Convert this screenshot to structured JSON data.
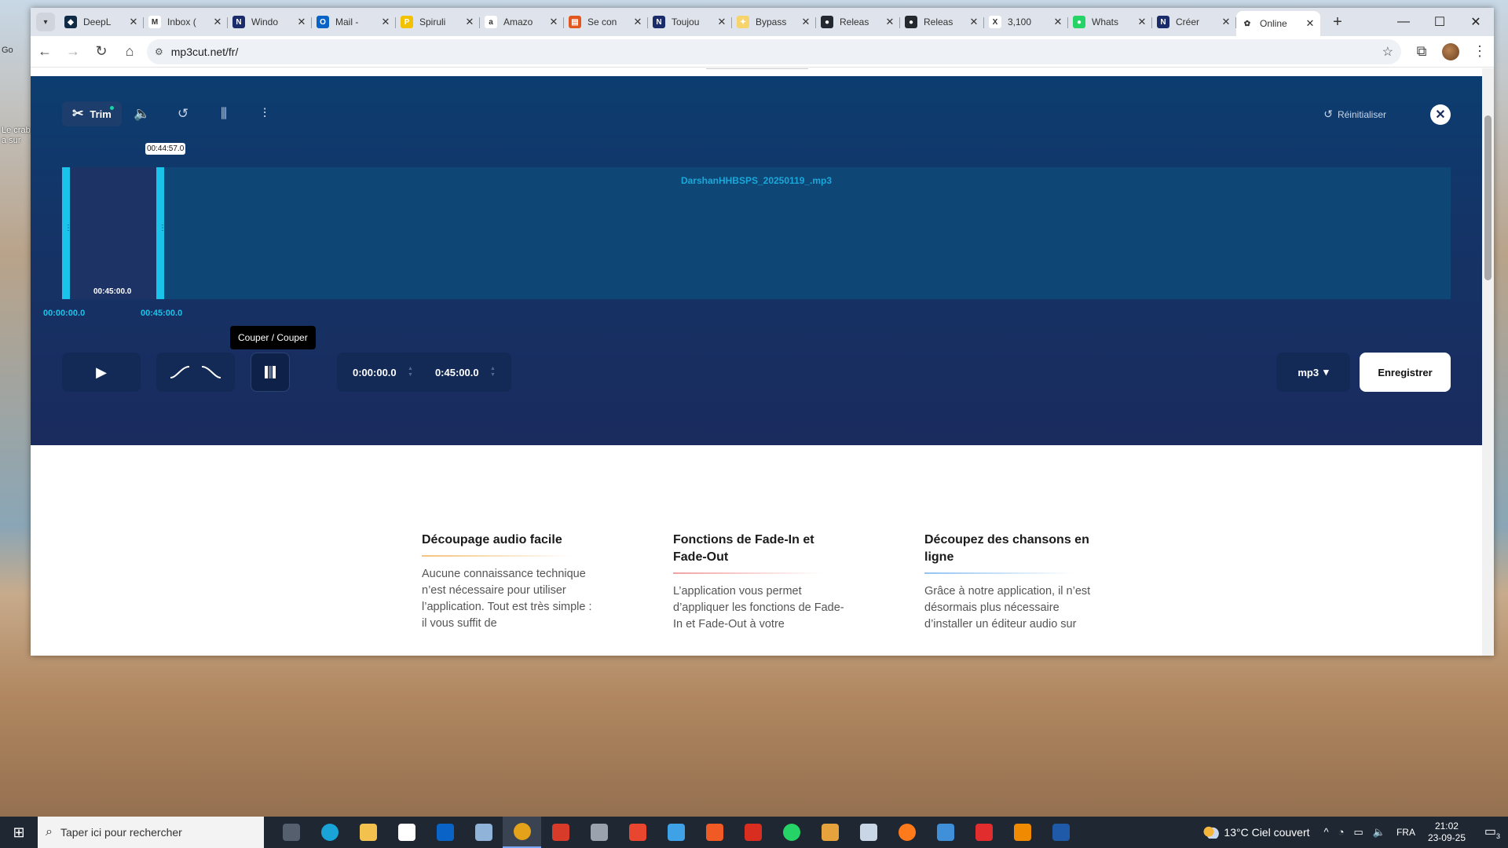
{
  "desktop": {
    "icon_text": "Le crab a sur",
    "icon_text2": "Go"
  },
  "browser": {
    "tabs": [
      {
        "title": "DeepL",
        "color": "#0f2b46",
        "glyph": "◆"
      },
      {
        "title": "Inbox (",
        "color": "#ffffff",
        "glyph": "M"
      },
      {
        "title": "Windo",
        "color": "#1b2c6b",
        "glyph": "N"
      },
      {
        "title": "Mail -",
        "color": "#0a64c8",
        "glyph": "O"
      },
      {
        "title": "Spiruli",
        "color": "#f2c200",
        "glyph": "P"
      },
      {
        "title": "Amazo",
        "color": "#ffffff",
        "glyph": "a"
      },
      {
        "title": "Se con",
        "color": "#e2571e",
        "glyph": "▤"
      },
      {
        "title": "Toujou",
        "color": "#1b2c6b",
        "glyph": "N"
      },
      {
        "title": "Bypass",
        "color": "#f6d36b",
        "glyph": "✦"
      },
      {
        "title": "Releas",
        "color": "#24292f",
        "glyph": "●"
      },
      {
        "title": "Releas",
        "color": "#24292f",
        "glyph": "●"
      },
      {
        "title": "3,100",
        "color": "#ffffff",
        "glyph": "X"
      },
      {
        "title": "Whats",
        "color": "#25d366",
        "glyph": "●"
      },
      {
        "title": "Créer",
        "color": "#1b2c6b",
        "glyph": "N"
      },
      {
        "title": "Online",
        "color": "#ffffff",
        "glyph": "✿",
        "active": true
      }
    ],
    "url": "mp3cut.net/fr/",
    "window_controls": [
      "—",
      "☐",
      "✕"
    ]
  },
  "editor": {
    "tool_trim_label": "Trim",
    "reset_label": "Réinitialiser",
    "filename": "DarshanHHBSPS_20250119_.mp3",
    "selection_duration": "00:45:00.0",
    "cursor_time": "00:44:57.0",
    "start_label": "00:00:00.0",
    "end_label": "00:45:00.0",
    "tooltip": "Couper / Couper",
    "start_time": "0:00:00.0",
    "end_time": "0:45:00.0",
    "format": "mp3",
    "save_label": "Enregistrer",
    "selection_fraction": 0.068
  },
  "features": [
    {
      "title": "Découpage audio facile",
      "text": "Aucune connaissance technique n’est nécessaire pour utiliser l’application. Tout est très simple : il vous suffit de"
    },
    {
      "title": "Fonctions de Fade-In et Fade-Out",
      "text": "L’application vous permet d’appliquer les fonctions de Fade-In et Fade-Out à votre"
    },
    {
      "title": "Découpez des chansons en ligne",
      "text": "Grâce à notre application, il n’est désormais plus nécessaire d’installer un éditeur audio sur"
    }
  ],
  "taskbar": {
    "search_placeholder": "Taper ici pour rechercher",
    "weather": "13°C  Ciel couvert",
    "lang": "FRA",
    "time": "21:02",
    "date": "23-09-25",
    "notif_count": "3",
    "apps": [
      {
        "name": "task-view",
        "color": "#555f6e"
      },
      {
        "name": "edge",
        "color": "#1aa3d6"
      },
      {
        "name": "file-explorer",
        "color": "#f2c14e"
      },
      {
        "name": "store",
        "color": "#ffffff"
      },
      {
        "name": "outlook",
        "color": "#0a64c8"
      },
      {
        "name": "remote-desktop",
        "color": "#8fb3d9"
      },
      {
        "name": "chrome",
        "color": "#e3a21a",
        "active": true
      },
      {
        "name": "app-red",
        "color": "#d93b2b"
      },
      {
        "name": "calculator",
        "color": "#9aa3ad"
      },
      {
        "name": "app-swirl",
        "color": "#e8462f"
      },
      {
        "name": "app-blue",
        "color": "#3fa2e6"
      },
      {
        "name": "brave",
        "color": "#f05a24"
      },
      {
        "name": "app-acrobat",
        "color": "#d92d20"
      },
      {
        "name": "whatsapp",
        "color": "#25d366"
      },
      {
        "name": "app-face",
        "color": "#e6a23c"
      },
      {
        "name": "app-doc",
        "color": "#c9d6e6"
      },
      {
        "name": "firefox",
        "color": "#ff7a1a"
      },
      {
        "name": "app-window",
        "color": "#3f8fd9"
      },
      {
        "name": "acrobat-reader",
        "color": "#e12d2d"
      },
      {
        "name": "vlc",
        "color": "#f08a00"
      },
      {
        "name": "app-hex",
        "color": "#1e5aa8"
      }
    ]
  }
}
